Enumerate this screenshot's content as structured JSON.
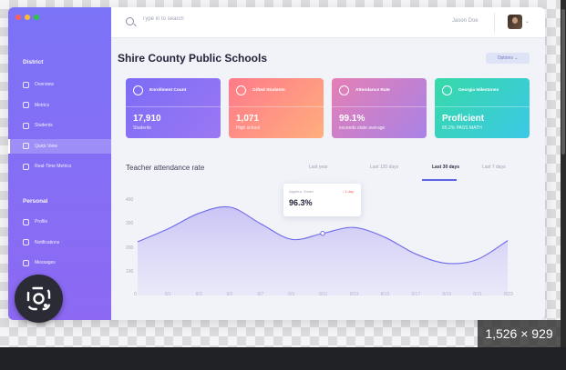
{
  "sidebar": {
    "window_dot_colors": [
      "#ff5f57",
      "#febc2e",
      "#28c840"
    ],
    "district_heading": "District",
    "district_items": [
      {
        "label": "Overview",
        "icon": "speedometer-icon"
      },
      {
        "label": "Metrics",
        "icon": "metrics-icon"
      },
      {
        "label": "Students",
        "icon": "user-icon"
      },
      {
        "label": "Quick View",
        "icon": "grid-icon",
        "active": true
      },
      {
        "label": "Real-Time Metrics",
        "icon": "pulse-icon"
      }
    ],
    "personal_heading": "Personal",
    "personal_items": [
      {
        "label": "Profile",
        "icon": "profile-icon"
      },
      {
        "label": "Notifications",
        "icon": "bell-icon"
      },
      {
        "label": "Messages",
        "icon": "message-icon"
      }
    ]
  },
  "topbar": {
    "search_placeholder": "Type in to search",
    "user_name": "Jason Doe",
    "avatar_icon": "avatar-photo",
    "menu_icon": "chevron-down-icon"
  },
  "page": {
    "title": "Shire County Public Schools",
    "options_label": "Options ⌄"
  },
  "cards": [
    {
      "label": "Enrollment Count",
      "value": "17,910",
      "sub": "Students",
      "gradient": [
        "#7c6cf6",
        "#9b78f3"
      ]
    },
    {
      "label": "Gifted Students",
      "value": "1,071",
      "sub": "High school",
      "gradient": [
        "#ff7a8a",
        "#ffae7e"
      ]
    },
    {
      "label": "Attendance Rate",
      "value": "99.1%",
      "sub": "exceeds state average",
      "gradient": [
        "#e57fb5",
        "#a982e6"
      ]
    },
    {
      "label": "Georgia Milestones",
      "value": "Proficient",
      "sub": "65.2% PASS MATH",
      "gradient": [
        "#37d9a8",
        "#3bc8e6"
      ]
    }
  ],
  "chart": {
    "title": "Teacher attendance rate",
    "tabs": [
      "Last year",
      "Last 120 days",
      "Last 30 days",
      "Last 7 days"
    ],
    "active_tab": "Last 30 days",
    "tooltip": {
      "label": "Algebra, Smart",
      "delta": "↓ 1 day",
      "value": "96.3%"
    },
    "accent": "#6f6bea"
  },
  "chart_data": {
    "type": "area",
    "title": "Teacher attendance rate",
    "y_ticks": [
      "400",
      "300",
      "200",
      "100"
    ],
    "x_ticks": [
      "0",
      "8/1",
      "8/3",
      "8/5",
      "8/7",
      "8/9",
      "8/11",
      "8/13",
      "8/15",
      "8/17",
      "8/19",
      "8/21",
      "8/23"
    ],
    "ylim": [
      0,
      400
    ],
    "x": [
      "0",
      "8/1",
      "8/3",
      "8/5",
      "8/7",
      "8/9",
      "8/11",
      "8/13",
      "8/15",
      "8/17",
      "8/19",
      "8/21",
      "8/23"
    ],
    "series": [
      {
        "values": [
          225,
          280,
          345,
          370,
          300,
          235,
          260,
          285,
          245,
          175,
          135,
          150,
          230
        ]
      }
    ],
    "highlight": {
      "x": "8/11",
      "value": 285
    },
    "grid": false,
    "legend": "none"
  },
  "overlay": {
    "lens_icon": "google-lens-icon",
    "dimensions": "1,526 × 929"
  }
}
